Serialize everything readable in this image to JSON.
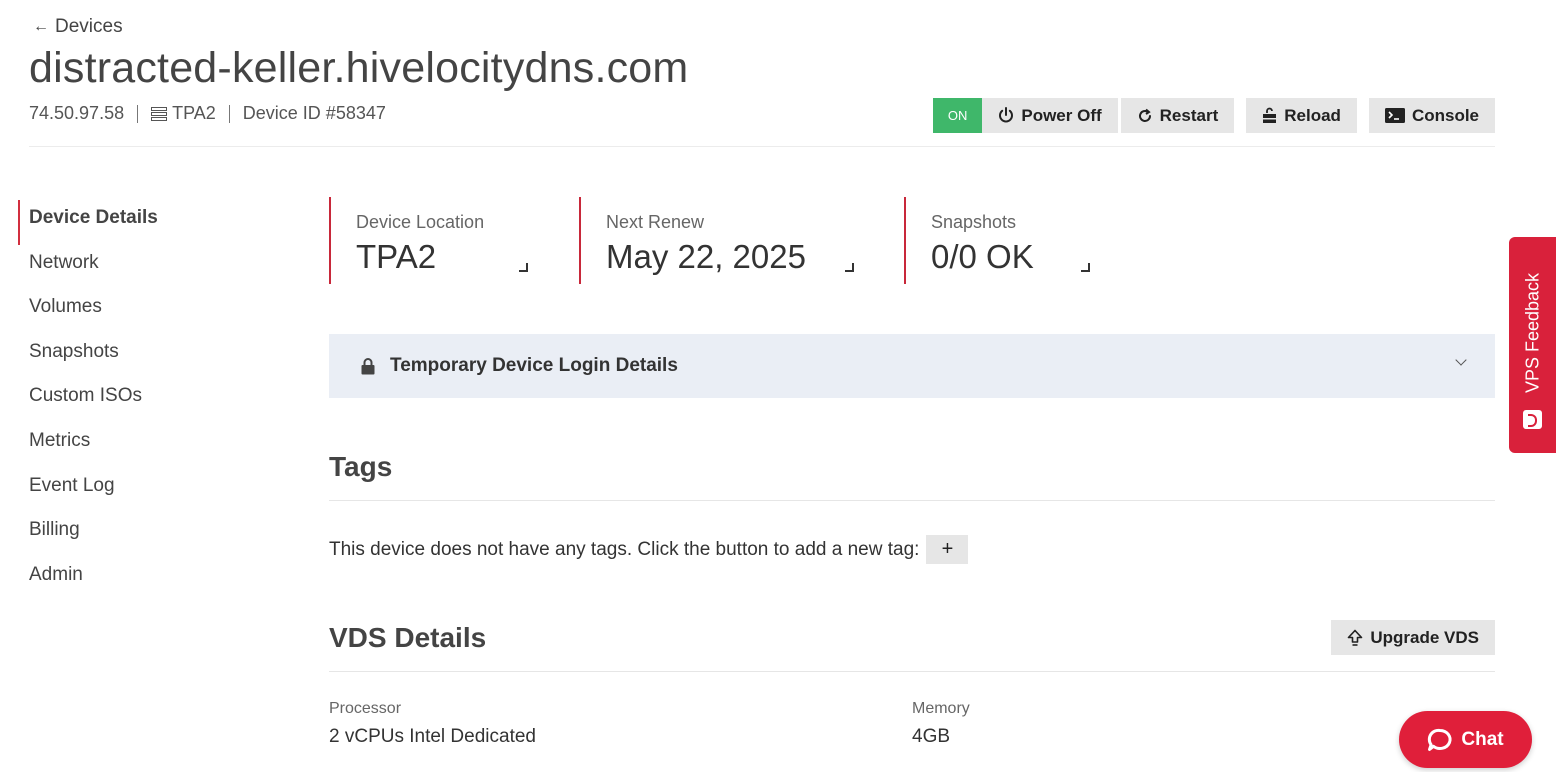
{
  "header": {
    "back_label": "Devices",
    "hostname": "distracted-keller.hivelocitydns.com",
    "ip": "74.50.97.58",
    "location": "TPA2",
    "device_id": "Device ID #58347"
  },
  "actions": {
    "status": "ON",
    "power_off": "Power Off",
    "restart": "Restart",
    "reload": "Reload",
    "console": "Console"
  },
  "sidebar": {
    "items": [
      {
        "label": "Device Details",
        "active": true
      },
      {
        "label": "Network"
      },
      {
        "label": "Volumes"
      },
      {
        "label": "Snapshots"
      },
      {
        "label": "Custom ISOs"
      },
      {
        "label": "Metrics"
      },
      {
        "label": "Event Log"
      },
      {
        "label": "Billing"
      },
      {
        "label": "Admin"
      }
    ]
  },
  "stats": [
    {
      "label": "Device Location",
      "value": "TPA2"
    },
    {
      "label": "Next Renew",
      "value": "May 22, 2025"
    },
    {
      "label": "Snapshots",
      "value": "0/0 OK"
    }
  ],
  "login_panel": {
    "title": "Temporary Device Login Details"
  },
  "tags": {
    "title": "Tags",
    "empty_text": "This device does not have any tags. Click the button to add a new tag:",
    "add_label": "+"
  },
  "vds": {
    "title": "VDS Details",
    "upgrade_label": "Upgrade VDS",
    "processor_label": "Processor",
    "processor_value": "2 vCPUs Intel Dedicated",
    "memory_label": "Memory",
    "memory_value": "4GB"
  },
  "feedback": {
    "label": "VPS Feedback"
  },
  "chat": {
    "label": "Chat"
  },
  "colors": {
    "accent": "#d22f3f",
    "on": "#3fb76a",
    "panel": "#eaeef5"
  }
}
